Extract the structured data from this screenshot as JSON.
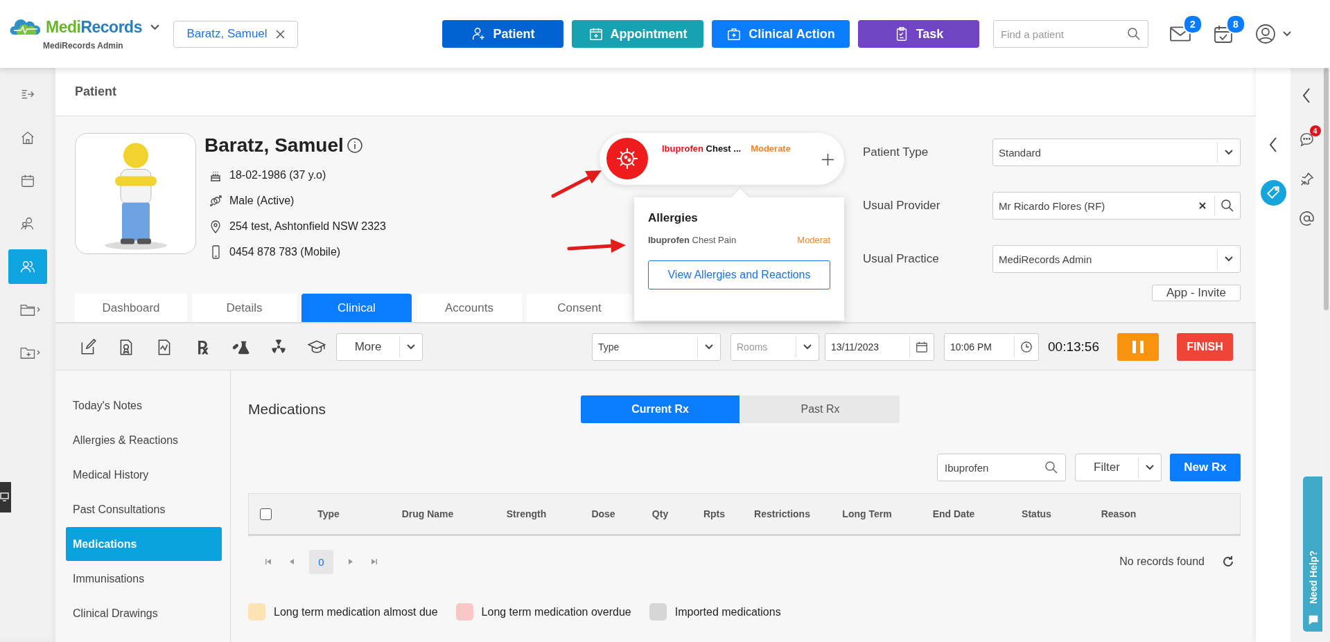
{
  "app": {
    "brand_first": "Medi",
    "brand_second": "Records",
    "subtitle": "MediRecords Admin"
  },
  "open_patient": {
    "label": "Baratz, Samuel"
  },
  "action_buttons": [
    {
      "kind": "patient",
      "label": "Patient",
      "color": "#0063d1"
    },
    {
      "kind": "appointment",
      "label": "Appointment",
      "color": "#17a2b2"
    },
    {
      "kind": "clinical",
      "label": "Clinical Action",
      "color": "#0a7cff"
    },
    {
      "kind": "task",
      "label": "Task",
      "color": "#7044c2"
    }
  ],
  "search": {
    "placeholder": "Find a patient"
  },
  "notifications": {
    "mail_count": "2",
    "calendar_count": "8"
  },
  "main_nav": [
    {
      "kind": "toggle",
      "selected": false
    },
    {
      "kind": "home",
      "selected": false
    },
    {
      "kind": "calendar",
      "selected": false
    },
    {
      "kind": "contacts",
      "selected": false
    },
    {
      "kind": "patients",
      "selected": true
    },
    {
      "kind": "folder",
      "selected": false
    },
    {
      "kind": "folder-add",
      "selected": false
    }
  ],
  "page_title": "Patient",
  "patient": {
    "name": "Baratz, Samuel",
    "details": [
      {
        "kind": "birth",
        "text": "18-02-1986 (37 y.o)"
      },
      {
        "kind": "gender",
        "text": "Male (Active)"
      },
      {
        "kind": "address",
        "text": "254 test, Ashtonfield NSW 2323"
      },
      {
        "kind": "phone",
        "text": "0454 878 783 (Mobile)"
      }
    ]
  },
  "allergy_badge": {
    "drug": "Ibuprofen",
    "reaction": "Chest ...",
    "severity": "Moderate"
  },
  "allergy_popup": {
    "title": "Allergies",
    "items": [
      {
        "drug": "Ibuprofen",
        "reaction": "Chest Pain",
        "severity": "Moderat"
      }
    ],
    "button": "View Allergies and Reactions"
  },
  "patient_fields": [
    {
      "kind": "select",
      "label": "Patient Type",
      "value": "Standard"
    },
    {
      "kind": "lookup",
      "label": "Usual Provider",
      "value": "Mr Ricardo Flores (RF)"
    },
    {
      "kind": "select",
      "label": "Usual Practice",
      "value": "MediRecords Admin"
    }
  ],
  "invite_button": "App - Invite",
  "tabs": [
    {
      "label": "Dashboard",
      "selected": false
    },
    {
      "label": "Details",
      "selected": false
    },
    {
      "label": "Clinical",
      "selected": true
    },
    {
      "label": "Accounts",
      "selected": false
    },
    {
      "label": "Consent",
      "selected": false
    }
  ],
  "toolbar": {
    "rx_glyph": "℞",
    "more": "More",
    "type_placeholder": "Type",
    "rooms_placeholder": "Rooms",
    "date": "13/11/2023",
    "time": "10:06 PM",
    "timer": "00:13:56",
    "finish": "FINISH"
  },
  "clinical_nav": [
    {
      "label": "Today's Notes",
      "selected": false
    },
    {
      "label": "Allergies & Reactions",
      "selected": false
    },
    {
      "label": "Medical History",
      "selected": false
    },
    {
      "label": "Past Consultations",
      "selected": false
    },
    {
      "label": "Medications",
      "selected": true
    },
    {
      "label": "Immunisations",
      "selected": false
    },
    {
      "label": "Clinical Drawings",
      "selected": false
    }
  ],
  "section_title": "Medications",
  "rx_tabs": [
    {
      "label": "Current Rx",
      "selected": true
    },
    {
      "label": "Past Rx",
      "selected": false
    }
  ],
  "rx_search": {
    "value": "Ibuprofen"
  },
  "filter": "Filter",
  "new_rx": "New Rx",
  "table": {
    "select_all_checked": false,
    "columns": [
      "Type",
      "Drug Name",
      "Strength",
      "Dose",
      "Qty",
      "Rpts",
      "Restrictions",
      "Long Term",
      "End Date",
      "Status",
      "Reason"
    ],
    "empty_message": "No records found"
  },
  "pagination": {
    "page": "0"
  },
  "legend": [
    {
      "label": "Long term medication almost due",
      "color": "#fde2b4"
    },
    {
      "label": "Long term medication overdue",
      "color": "#f9c6c6"
    },
    {
      "label": "Imported medications",
      "color": "#d6d6d6"
    }
  ],
  "side_rail": {
    "chat_badge": "4"
  },
  "help_tab": "Need Help?"
}
